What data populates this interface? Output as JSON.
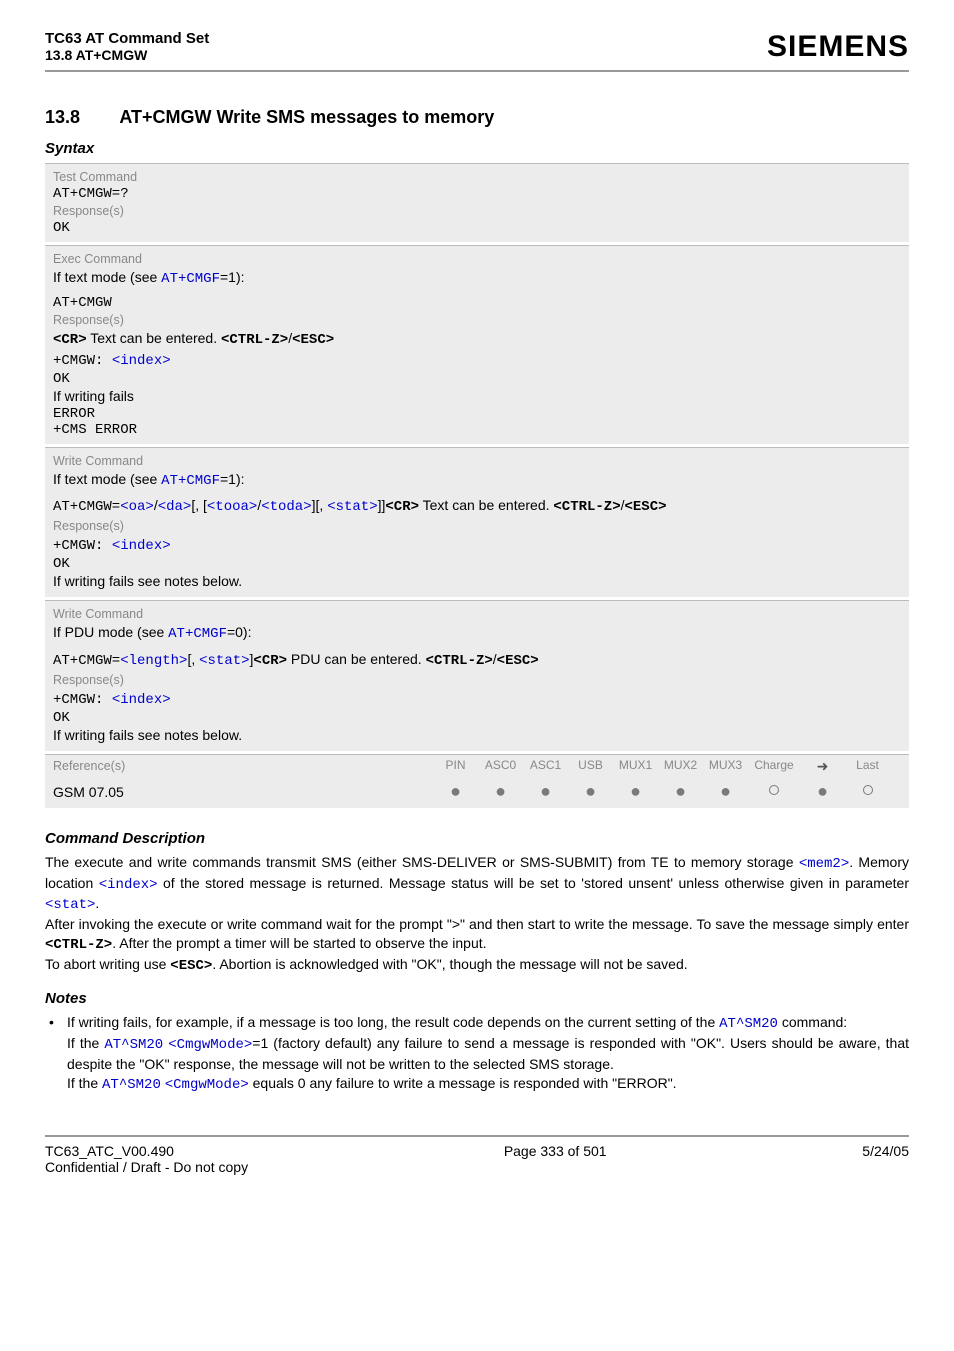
{
  "header": {
    "doc_title": "TC63 AT Command Set",
    "section_ref": "13.8 AT+CMGW",
    "logo": "SIEMENS"
  },
  "section": {
    "number": "13.8",
    "title": "AT+CMGW   Write SMS messages to memory"
  },
  "syntax_label": "Syntax",
  "blocks": {
    "test": {
      "type_label": "Test Command",
      "command": "AT+CMGW=?",
      "resp_label": "Response(s)",
      "resp1": "OK"
    },
    "exec": {
      "type_label": "Exec Command",
      "cond_prefix": "If text mode (see ",
      "cond_link": "AT+CMGF",
      "cond_suffix": "=1):",
      "command": "AT+CMGW",
      "resp_label": "Response(s)",
      "line1_cr": "<CR>",
      "line1_mid": " Text can be entered. ",
      "line1_ctrlz": "<CTRL-Z>",
      "line1_slash": "/",
      "line1_esc": "<ESC>",
      "line2_pre": "+CMGW: ",
      "line2_index": "<index>",
      "line3": "OK",
      "line4": "If writing fails",
      "line5": "ERROR",
      "line6": "+CMS ERROR"
    },
    "write1": {
      "type_label": "Write Command",
      "cond_prefix": "If text mode (see ",
      "cond_link": "AT+CMGF",
      "cond_suffix": "=1):",
      "cmd_pre": "AT+CMGW=",
      "p_oa": "<oa>",
      "slash1": "/",
      "p_da": "<da>",
      "br1": "[, [",
      "p_tooa": "<tooa>",
      "slash2": "/",
      "p_toda": "<toda>",
      "br2": "][, ",
      "p_stat": "<stat>",
      "br3": "]]",
      "cr": "<CR>",
      "mid": " Text can be entered. ",
      "ctrlz": "<CTRL-Z>",
      "slash3": "/",
      "esc": "<ESC>",
      "resp_label": "Response(s)",
      "r1_pre": "+CMGW: ",
      "r1_index": "<index>",
      "r2": "OK",
      "r3": "If writing fails see notes below."
    },
    "write2": {
      "type_label": "Write Command",
      "cond_prefix": "If PDU mode (see ",
      "cond_link": "AT+CMGF",
      "cond_suffix": "=0):",
      "cmd_pre": "AT+CMGW=",
      "p_length": "<length>",
      "br1": "[, ",
      "p_stat": "<stat>",
      "br2": "]",
      "cr": "<CR>",
      "mid": " PDU can be entered. ",
      "ctrlz": "<CTRL-Z>",
      "slash": "/",
      "esc": "<ESC>",
      "resp_label": "Response(s)",
      "r1_pre": "+CMGW: ",
      "r1_index": "<index>",
      "r2": "OK",
      "r3": "If writing fails see notes below."
    }
  },
  "ref_table": {
    "ref_label": "Reference(s)",
    "cols": [
      "PIN",
      "ASC0",
      "ASC1",
      "USB",
      "MUX1",
      "MUX2",
      "MUX3",
      "Charge",
      "➜",
      "Last"
    ],
    "ref_value": "GSM 07.05",
    "dots": [
      "filled",
      "filled",
      "filled",
      "filled",
      "filled",
      "filled",
      "filled",
      "empty",
      "filled",
      "empty"
    ]
  },
  "cmddesc": {
    "label": "Command Description",
    "p1a": "The execute and write commands transmit SMS (either SMS-DELIVER or SMS-SUBMIT) from TE to memory storage ",
    "mem2": "<mem2>",
    "p1b": ". Memory location ",
    "index": "<index>",
    "p1c": " of the stored message is returned. Message status will be set to 'stored unsent' unless otherwise given in parameter ",
    "stat": "<stat>",
    "p1d": ".",
    "p2a": "After invoking the execute or write command wait for the prompt \">\" and then start to write the message. To save the message simply enter ",
    "ctrlz": "<CTRL-Z>",
    "p2b": ". After the prompt a timer will be started to observe the input.",
    "p3a": "To abort writing use ",
    "esc": "<ESC>",
    "p3b": ". Abortion is acknowledged with \"OK\", though the message will not be saved."
  },
  "notes": {
    "label": "Notes",
    "n1a": "If writing fails, for example, if a message is too long, the result code depends on the current setting of the ",
    "sm20": "AT^SM20",
    "n1b": " command:",
    "n2a": "If the ",
    "sm20b": "AT^SM20",
    "sp1": " ",
    "cmgw1": "<CmgwMode>",
    "n2b": "=1 (factory default) any failure to send a message is responded with \"OK\". Users should be aware, that despite the \"OK\" response, the message will not be written to the selected SMS storage.",
    "n3a": "If the ",
    "sm20c": "AT^SM20",
    "sp2": " ",
    "cmgw2": "<CmgwMode>",
    "n3b": " equals 0 any failure to write a message is responded with \"ERROR\"."
  },
  "footer": {
    "left1": "TC63_ATC_V00.490",
    "left2": "Confidential / Draft - Do not copy",
    "center": "Page 333 of 501",
    "right": "5/24/05"
  }
}
